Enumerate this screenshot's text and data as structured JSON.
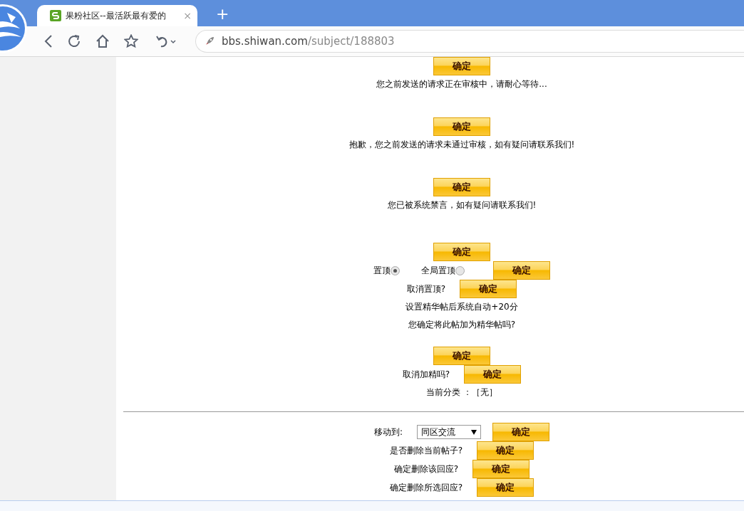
{
  "browser": {
    "tab": {
      "title": "果粉社区--最活跃最有爱的",
      "close": "×"
    },
    "new_tab": "+",
    "address": {
      "domain": "bbs.shiwan.com",
      "path": "/subject/188803"
    }
  },
  "sections": [
    {
      "items": [
        {
          "kind": "button",
          "label": "确定"
        },
        {
          "kind": "text",
          "text": "您之前发送的请求正在审核中，请耐心等待..."
        }
      ]
    },
    {
      "items": [
        {
          "kind": "button",
          "label": "确定"
        },
        {
          "kind": "text",
          "text": "抱歉，您之前发送的请求未通过审核，如有疑问请联系我们!"
        }
      ]
    },
    {
      "items": [
        {
          "kind": "button",
          "label": "确定"
        },
        {
          "kind": "text",
          "text": "您已被系统禁言，如有疑问请联系我们!"
        }
      ]
    },
    {
      "items": [
        {
          "kind": "button",
          "label": "确定"
        },
        {
          "kind": "radio_row",
          "options": [
            {
              "label": "置顶",
              "selected": true
            },
            {
              "label": "全局置顶",
              "selected": false
            }
          ],
          "button": "确定"
        },
        {
          "kind": "label_button",
          "label": "取消置顶?",
          "button": "确定"
        },
        {
          "kind": "text",
          "text": "设置精华帖后系统自动+20分"
        },
        {
          "kind": "text",
          "text": "您确定将此帖加为精华帖吗?"
        }
      ]
    },
    {
      "items": [
        {
          "kind": "button",
          "label": "确定"
        },
        {
          "kind": "label_button",
          "label": "取消加精吗?",
          "button": "确定"
        },
        {
          "kind": "text",
          "text": "当前分类 ：［无］"
        }
      ]
    },
    {
      "items": [
        {
          "kind": "divider"
        },
        {
          "kind": "select_row",
          "label": "移动到:",
          "value": "同区交流",
          "button": "确定"
        },
        {
          "kind": "label_button",
          "label": "是否删除当前帖子?",
          "button": "确定"
        },
        {
          "kind": "label_button",
          "label": "确定删除该回应?",
          "button": "确定"
        },
        {
          "kind": "label_button",
          "label": "确定删除所选回应?",
          "button": "确定"
        }
      ]
    }
  ]
}
